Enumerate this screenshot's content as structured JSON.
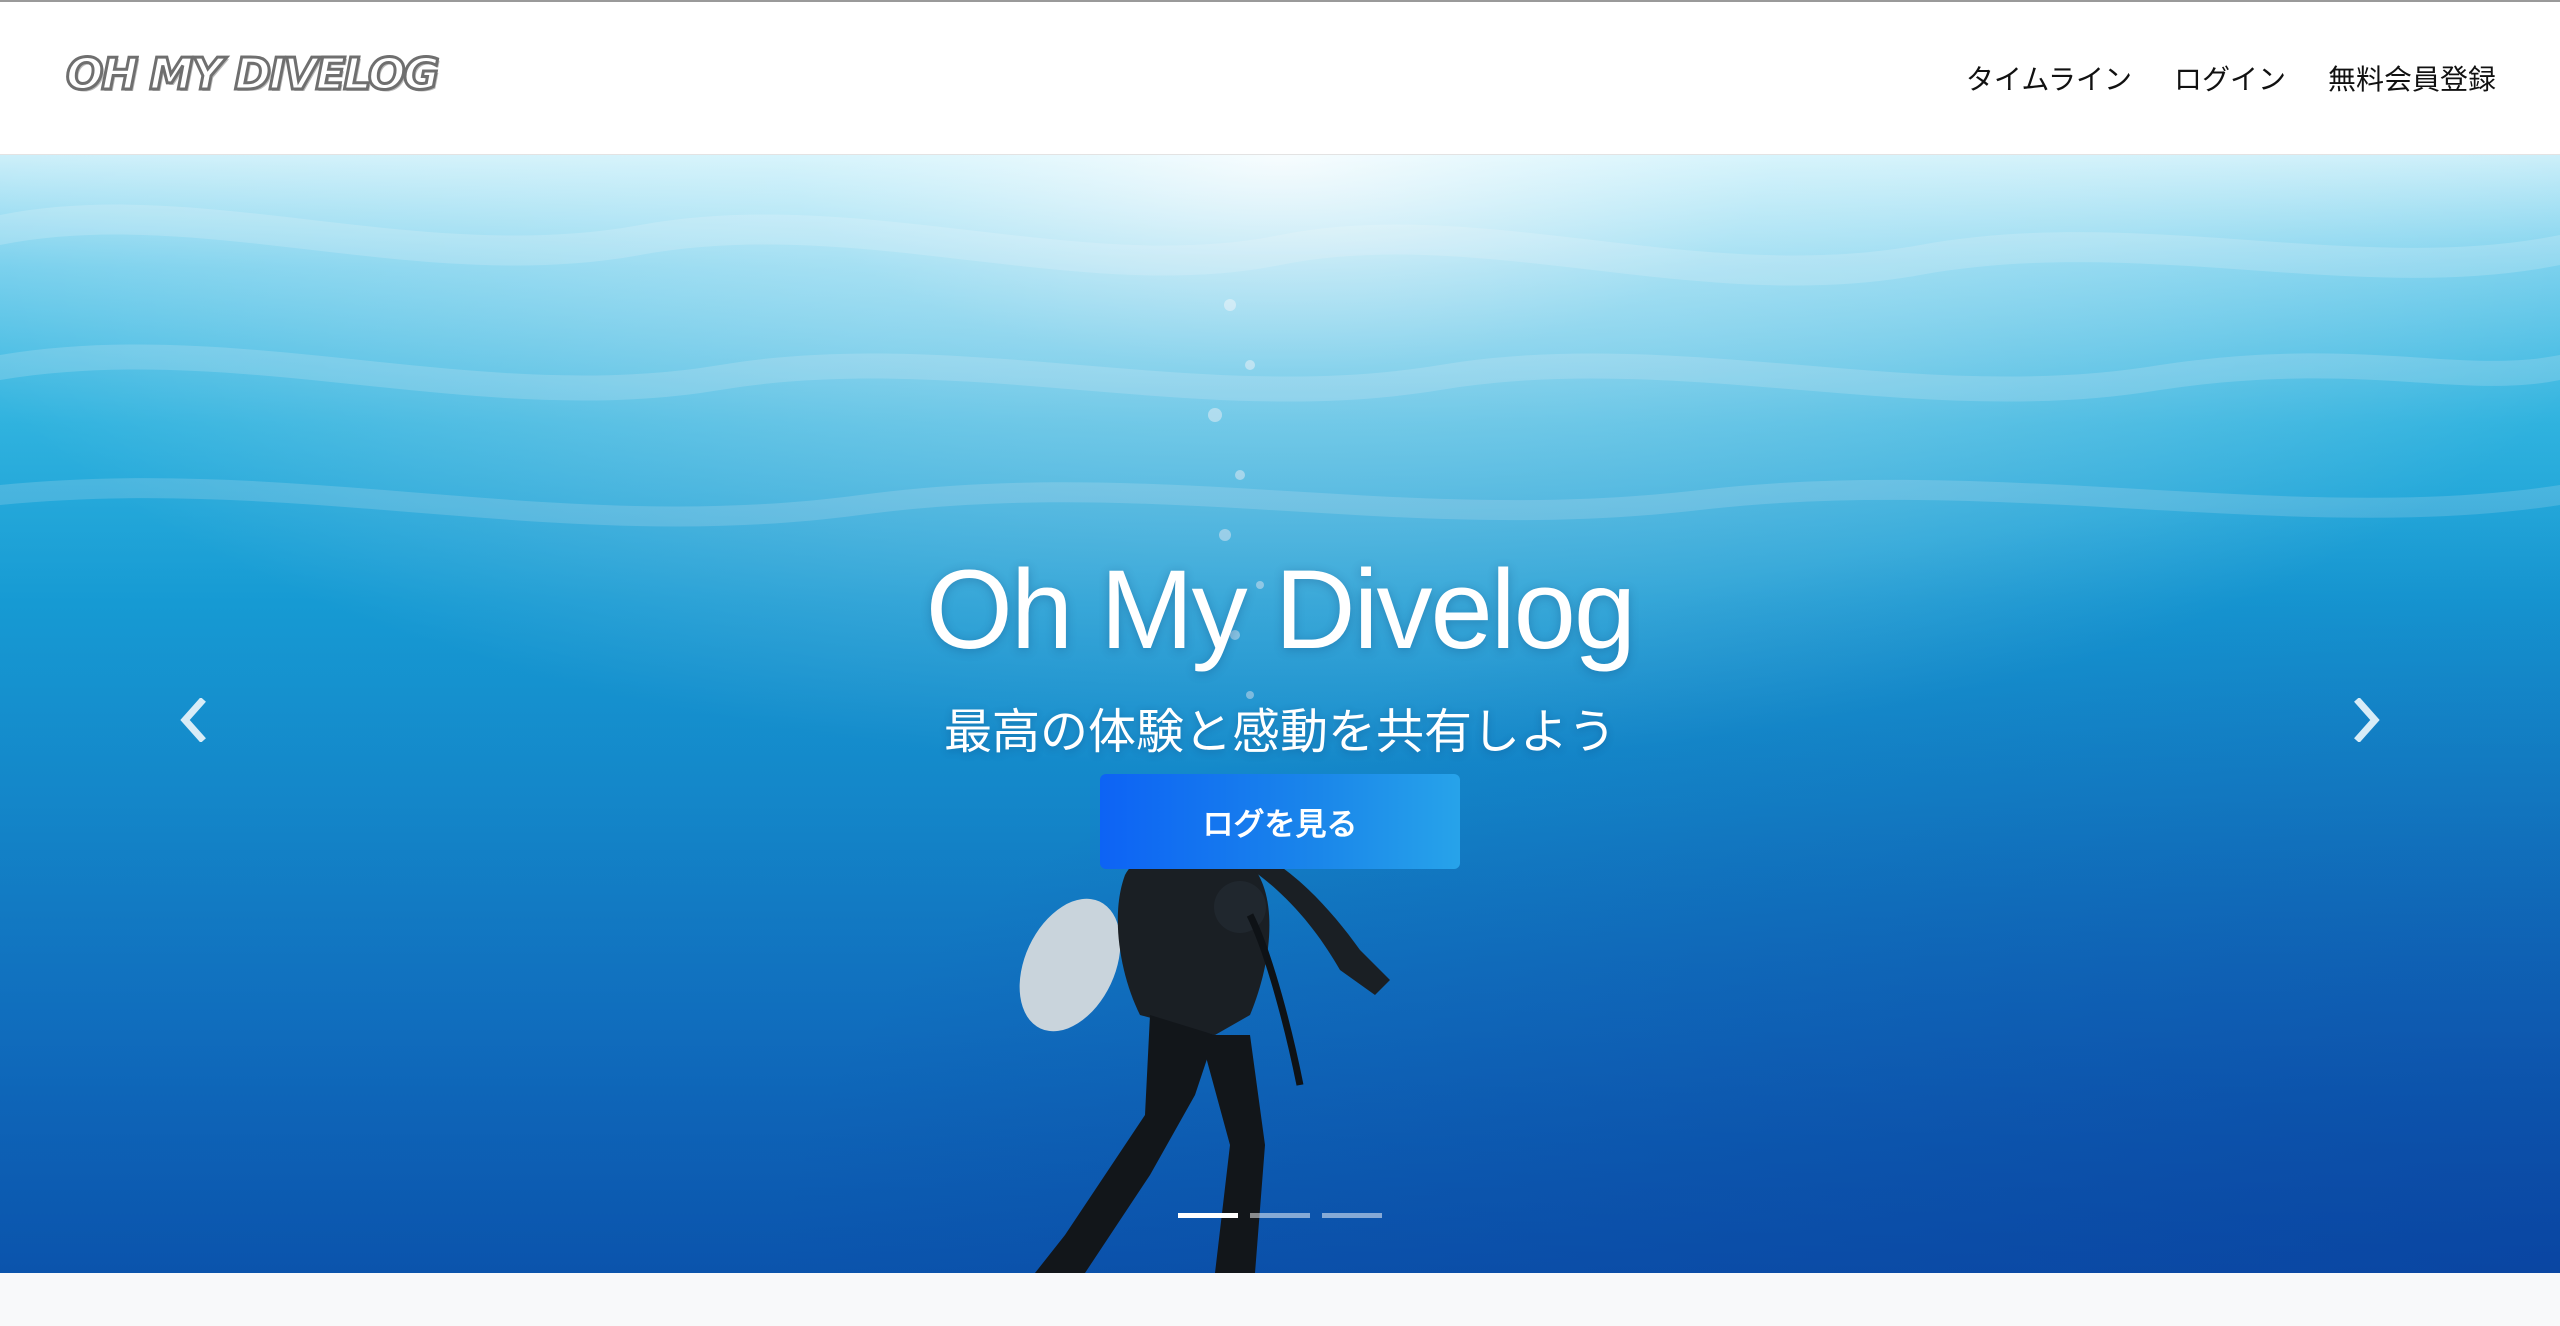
{
  "navbar": {
    "brand": "OH MY DIVELOG",
    "links": [
      {
        "label": "タイムライン"
      },
      {
        "label": "ログイン"
      },
      {
        "label": "無料会員登録"
      }
    ]
  },
  "hero": {
    "title": "Oh My Divelog",
    "subtitle": "最高の体験と感動を共有しよう",
    "cta_label": "ログを見る",
    "indicators": {
      "count": 3,
      "active_index": 0
    },
    "prev_icon": "chevron-left-icon",
    "next_icon": "chevron-right-icon"
  },
  "colors": {
    "accent": "#0d63f5",
    "water": "#18a9de"
  }
}
